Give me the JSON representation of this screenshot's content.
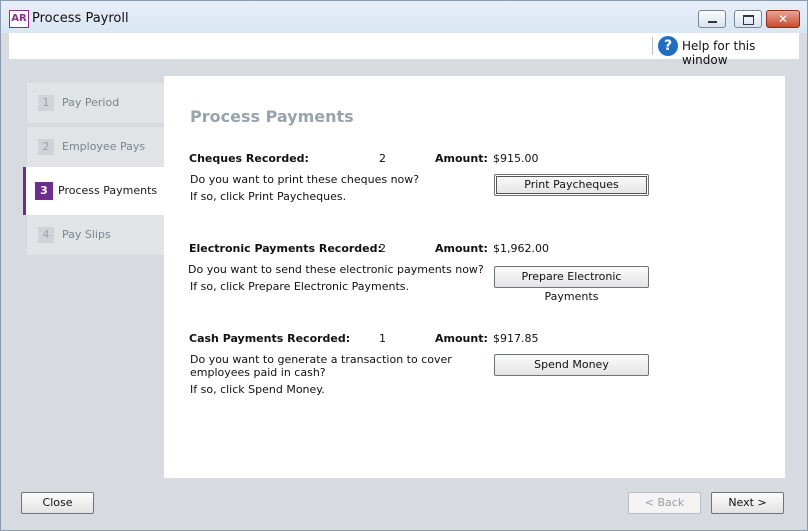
{
  "window": {
    "app_icon": "AR",
    "title": "Process Payroll"
  },
  "help": {
    "label": "Help for this window"
  },
  "steps": [
    {
      "num": "1",
      "label": "Pay Period"
    },
    {
      "num": "2",
      "label": "Employee Pays"
    },
    {
      "num": "3",
      "label": "Process Payments"
    },
    {
      "num": "4",
      "label": "Pay Slips"
    }
  ],
  "active_step": 3,
  "main": {
    "heading": "Process Payments",
    "cheques": {
      "label": "Cheques Recorded:",
      "count": "2",
      "amount_label": "Amount:",
      "amount": "$915.00",
      "question": "Do you want to print these cheques now?",
      "instruction": "If so, click Print Paycheques.",
      "button": "Print Paycheques"
    },
    "electronic": {
      "label": "Electronic Payments Recorded:",
      "count": "2",
      "amount_label": "Amount:",
      "amount": "$1,962.00",
      "question": "Do you want to send these electronic payments now?",
      "instruction": "If so, click Prepare Electronic Payments.",
      "button": "Prepare Electronic Payments"
    },
    "cash": {
      "label": "Cash Payments Recorded:",
      "count": "1",
      "amount_label": "Amount:",
      "amount": "$917.85",
      "question_line1": "Do you want to generate a transaction to cover",
      "question_line2": "employees paid in cash?",
      "instruction": "If so, click Spend Money.",
      "button": "Spend Money"
    }
  },
  "footer": {
    "close": "Close",
    "back": "< Back",
    "next": "Next >"
  },
  "colors": {
    "accent": "#6b2e8c",
    "help_icon": "#1f6fc1"
  }
}
